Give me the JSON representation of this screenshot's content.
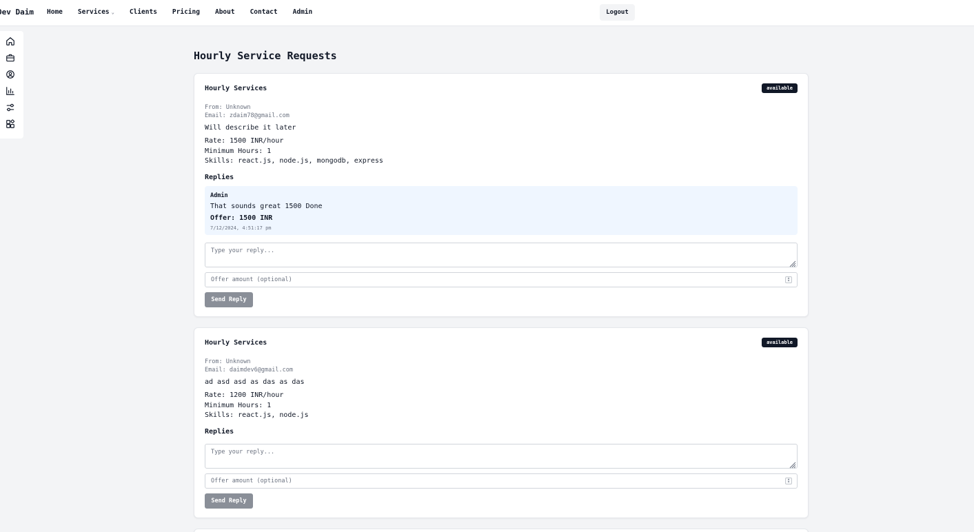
{
  "brand": "Dev Daim",
  "nav": {
    "items": [
      "Home",
      "Services",
      "Clients",
      "Pricing",
      "About",
      "Contact",
      "Admin"
    ],
    "logout_label": "Logout"
  },
  "sidebar": {
    "icons": [
      "home-icon",
      "briefcase-icon",
      "user-circle-icon",
      "bar-chart-icon",
      "sliders-icon",
      "widgets-icon"
    ]
  },
  "page_title": "Hourly Service Requests",
  "requests": [
    {
      "title": "Hourly Services",
      "status": "available",
      "from": "From: Unknown",
      "email": "Email: zdaim78@gmail.com",
      "description": "Will describe it later",
      "rate": "Rate: 1500 INR/hour",
      "min_hours": "Minimum Hours: 1",
      "skills": "Skills: react.js, node.js, mongodb, express",
      "replies_heading": "Replies",
      "replies": [
        {
          "author": "Admin",
          "message": "That sounds great 1500 Done",
          "offer": "Offer: 1500 INR",
          "timestamp": "7/12/2024, 4:51:17 pm"
        }
      ],
      "reply_placeholder": "Type your reply...",
      "offer_placeholder": "Offer amount (optional)",
      "send_label": "Send Reply"
    },
    {
      "title": "Hourly Services",
      "status": "available",
      "from": "From: Unknown",
      "email": "Email: daimdev6@gmail.com",
      "description": "ad asd asd as das as das",
      "rate": "Rate: 1200 INR/hour",
      "min_hours": "Minimum Hours: 1",
      "skills": "Skills: react.js, node.js",
      "replies_heading": "Replies",
      "replies": [],
      "reply_placeholder": "Type your reply...",
      "offer_placeholder": "Offer amount (optional)",
      "send_label": "Send Reply"
    }
  ]
}
